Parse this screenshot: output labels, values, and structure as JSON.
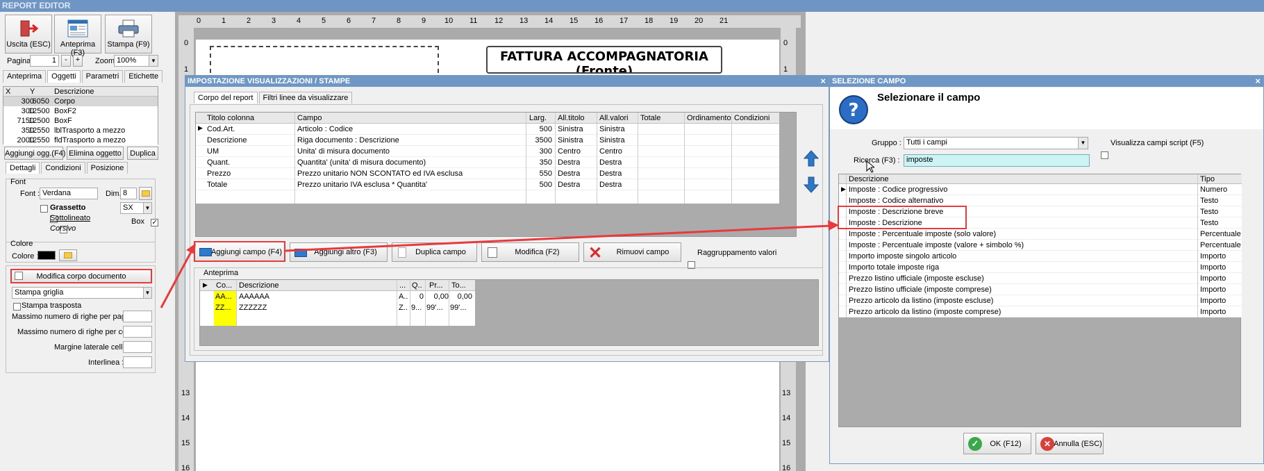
{
  "app": {
    "title": "REPORT EDITOR"
  },
  "toolbar": {
    "exit_label": "Uscita (ESC)",
    "preview_label": "Anteprima (F3)",
    "print_label": "Stampa (F9)"
  },
  "pager": {
    "page_label": "Pagina",
    "page_value": "1",
    "minus": "-",
    "plus": "+",
    "zoom_label": "Zoom",
    "zoom_value": "100%"
  },
  "left_tabs": [
    "Anteprima",
    "Oggetti",
    "Parametri",
    "Etichette"
  ],
  "objects_table": {
    "headers": [
      "X",
      "Y",
      "Descrizione"
    ],
    "rows": [
      [
        "300",
        "6050",
        "Corpo"
      ],
      [
        "300",
        "12500",
        "BoxF2"
      ],
      [
        "7150",
        "12500",
        "BoxF"
      ],
      [
        "350",
        "12550",
        "lblTrasporto a mezzo"
      ],
      [
        "2000",
        "12550",
        "fldTrasporto a mezzo"
      ]
    ]
  },
  "object_buttons": {
    "add": "Aggiungi ogg.(F4)",
    "delete": "Elimina oggetto",
    "duplicate": "Duplica"
  },
  "detail_tabs": [
    "Dettagli",
    "Condizioni",
    "Posizione"
  ],
  "font_group": {
    "title": "Font",
    "font_label": "Font :",
    "font_value": "Verdana",
    "dim_label": "Dim.",
    "dim_value": "8",
    "bold": "Grassetto",
    "underline": "Sottolineato",
    "italic": "Corsivo",
    "align_value": "SX",
    "box_label": "Box"
  },
  "color_group": {
    "title": "Colore",
    "color_label": "Colore :",
    "swatch": "#000000"
  },
  "body_group": {
    "edit_button": "Modifica corpo documento",
    "grid_select": "Stampa griglia",
    "transpose": "Stampa trasposta",
    "max_rows_page": "Massimo numero di righe per pagina :",
    "max_rows_cell": "Massimo numero di righe per cella :",
    "margin": "Margine laterale celle :",
    "interline": "Interlinea :"
  },
  "ruler": {
    "top": [
      "0",
      "1",
      "2",
      "3",
      "4",
      "5",
      "6",
      "7",
      "8",
      "9",
      "10",
      "11",
      "12",
      "13",
      "14",
      "15",
      "16",
      "17",
      "18",
      "19",
      "20",
      "21"
    ],
    "left": [
      "0",
      "1",
      "13",
      "14",
      "15",
      "16"
    ],
    "right": [
      "0",
      "1",
      "13",
      "14",
      "15",
      "16"
    ]
  },
  "page_title": "FATTURA ACCOMPAGNATORIA",
  "page_subtitle": "(Fronte)",
  "dialog_imp": {
    "title": "IMPOSTAZIONE VISUALIZZAZIONI / STAMPE",
    "close": "×",
    "tabs": [
      "Corpo del report",
      "Filtri linee da visualizzare"
    ],
    "columns_table": {
      "headers": [
        "Titolo colonna",
        "Campo",
        "Larg.",
        "All.titolo",
        "All.valori",
        "Totale",
        "Ordinamento",
        "Condizioni"
      ],
      "rows": [
        [
          "Cod.Art.",
          "Articolo : Codice",
          "500",
          "Sinistra",
          "Sinistra"
        ],
        [
          "Descrizione",
          "Riga documento : Descrizione",
          "3500",
          "Sinistra",
          "Sinistra"
        ],
        [
          "UM",
          "Unita' di misura documento",
          "300",
          "Centro",
          "Centro"
        ],
        [
          "Quant.",
          "Quantita' (unita' di misura documento)",
          "350",
          "Destra",
          "Destra"
        ],
        [
          "Prezzo",
          "Prezzo unitario NON SCONTATO ed IVA esclusa",
          "550",
          "Destra",
          "Destra"
        ],
        [
          "Totale",
          "Prezzo unitario IVA esclusa * Quantita'",
          "500",
          "Destra",
          "Destra"
        ]
      ]
    },
    "buttons": {
      "add_field": "Aggiungi campo (F4)",
      "add_other": "Aggiungi altro (F3)",
      "duplicate": "Duplica campo",
      "edit": "Modifica (F2)",
      "remove": "Rimuovi campo",
      "grouping": "Raggruppamento valori"
    },
    "preview_label": "Anteprima",
    "preview_table": {
      "headers": [
        "Co...",
        "Descrizione",
        "...",
        "Q...",
        "Pr...",
        "To..."
      ],
      "rows": [
        [
          "AA...",
          "AAAAAA",
          "A...",
          "0",
          "0,00",
          "0,00"
        ],
        [
          "ZZ...",
          "ZZZZZZ",
          "Z...",
          "9...",
          "99'...",
          "99'..."
        ]
      ]
    }
  },
  "dialog_sel": {
    "title": "SELEZIONE CAMPO",
    "close": "×",
    "heading": "Selezionare il campo",
    "group_label": "Gruppo :",
    "group_value": "Tutti i campi",
    "script_label": "Visualizza campi script (F5)",
    "search_label": "Ricerca (F3) :",
    "search_value": "imposte",
    "headers": [
      "Descrizione",
      "Tipo"
    ],
    "rows": [
      [
        "Imposte : Codice progressivo",
        "Numero"
      ],
      [
        "Imposte : Codice alternativo",
        "Testo"
      ],
      [
        "Imposte : Descrizione breve",
        "Testo"
      ],
      [
        "Imposte : Descrizione",
        "Testo"
      ],
      [
        "Imposte : Percentuale imposte (solo valore)",
        "Percentuale"
      ],
      [
        "Imposte : Percentuale imposte (valore + simbolo %)",
        "Percentuale"
      ],
      [
        "Importo imposte singolo articolo",
        "Importo"
      ],
      [
        "Importo totale imposte riga",
        "Importo"
      ],
      [
        "Prezzo listino ufficiale (imposte escluse)",
        "Importo"
      ],
      [
        "Prezzo listino ufficiale (imposte comprese)",
        "Importo"
      ],
      [
        "Prezzo articolo da listino (imposte escluse)",
        "Importo"
      ],
      [
        "Prezzo articolo da listino (imposte comprese)",
        "Importo"
      ]
    ],
    "ok": "OK (F12)",
    "cancel": "Annulla (ESC)"
  },
  "colors": {
    "title_bar": "#6e95c4",
    "highlight": "#e8393b",
    "search_bg": "#cdf4f4",
    "yellow": "#ffff00"
  }
}
